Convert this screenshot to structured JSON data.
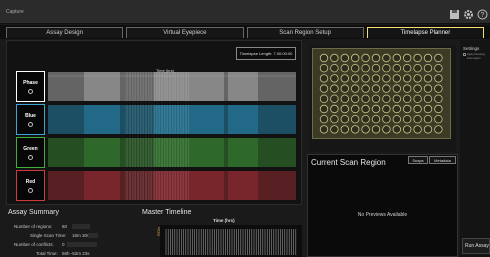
{
  "window": {
    "title": "Capture",
    "icons": [
      "save-icon",
      "gear-icon",
      "help-icon"
    ]
  },
  "tabs": [
    {
      "label": "Assay Design",
      "active": false
    },
    {
      "label": "Virtual Eyepiece",
      "active": false
    },
    {
      "label": "Scan Region Setup",
      "active": false
    },
    {
      "label": "Timelapse Planner",
      "active": true
    }
  ],
  "timelapse": {
    "length_label": "Timelapse Length: 7.00:00:00",
    "axis_label": "Time (hrs)",
    "channels": [
      {
        "label": "Phase",
        "color": "#c9c9c9",
        "border": "#ffffff"
      },
      {
        "label": "Blue",
        "color": "#2a9bc8",
        "border": "#3ea4d8"
      },
      {
        "label": "Green",
        "color": "#3f9a3a",
        "border": "#3fae3a"
      },
      {
        "label": "Red",
        "color": "#b2343c",
        "border": "#d03a3a"
      }
    ]
  },
  "scan_region": {
    "title": "Current Scan Region",
    "snaps_label": "Snaps",
    "metadata_label": "Metadata",
    "empty_text": "No Previews Available"
  },
  "settings": {
    "title": "Settings",
    "line1": "Apply Focusing",
    "line2": "scan region"
  },
  "run_button": "Run Assay",
  "assay_summary": {
    "title": "Assay Summary",
    "regions_label": "Number of regions:",
    "regions_value": "60",
    "single_scan_label": "Single Scan Time:",
    "single_scan_value": "16m 30s",
    "conflicts_label": "Number of conflicts:",
    "conflicts_value": "0",
    "total_label": "Total Time:",
    "total_value": "56h -52m 23s"
  },
  "master_timeline": {
    "title": "Master Timeline",
    "time_label": "Time (hrs)",
    "side_label": "ROIs"
  }
}
